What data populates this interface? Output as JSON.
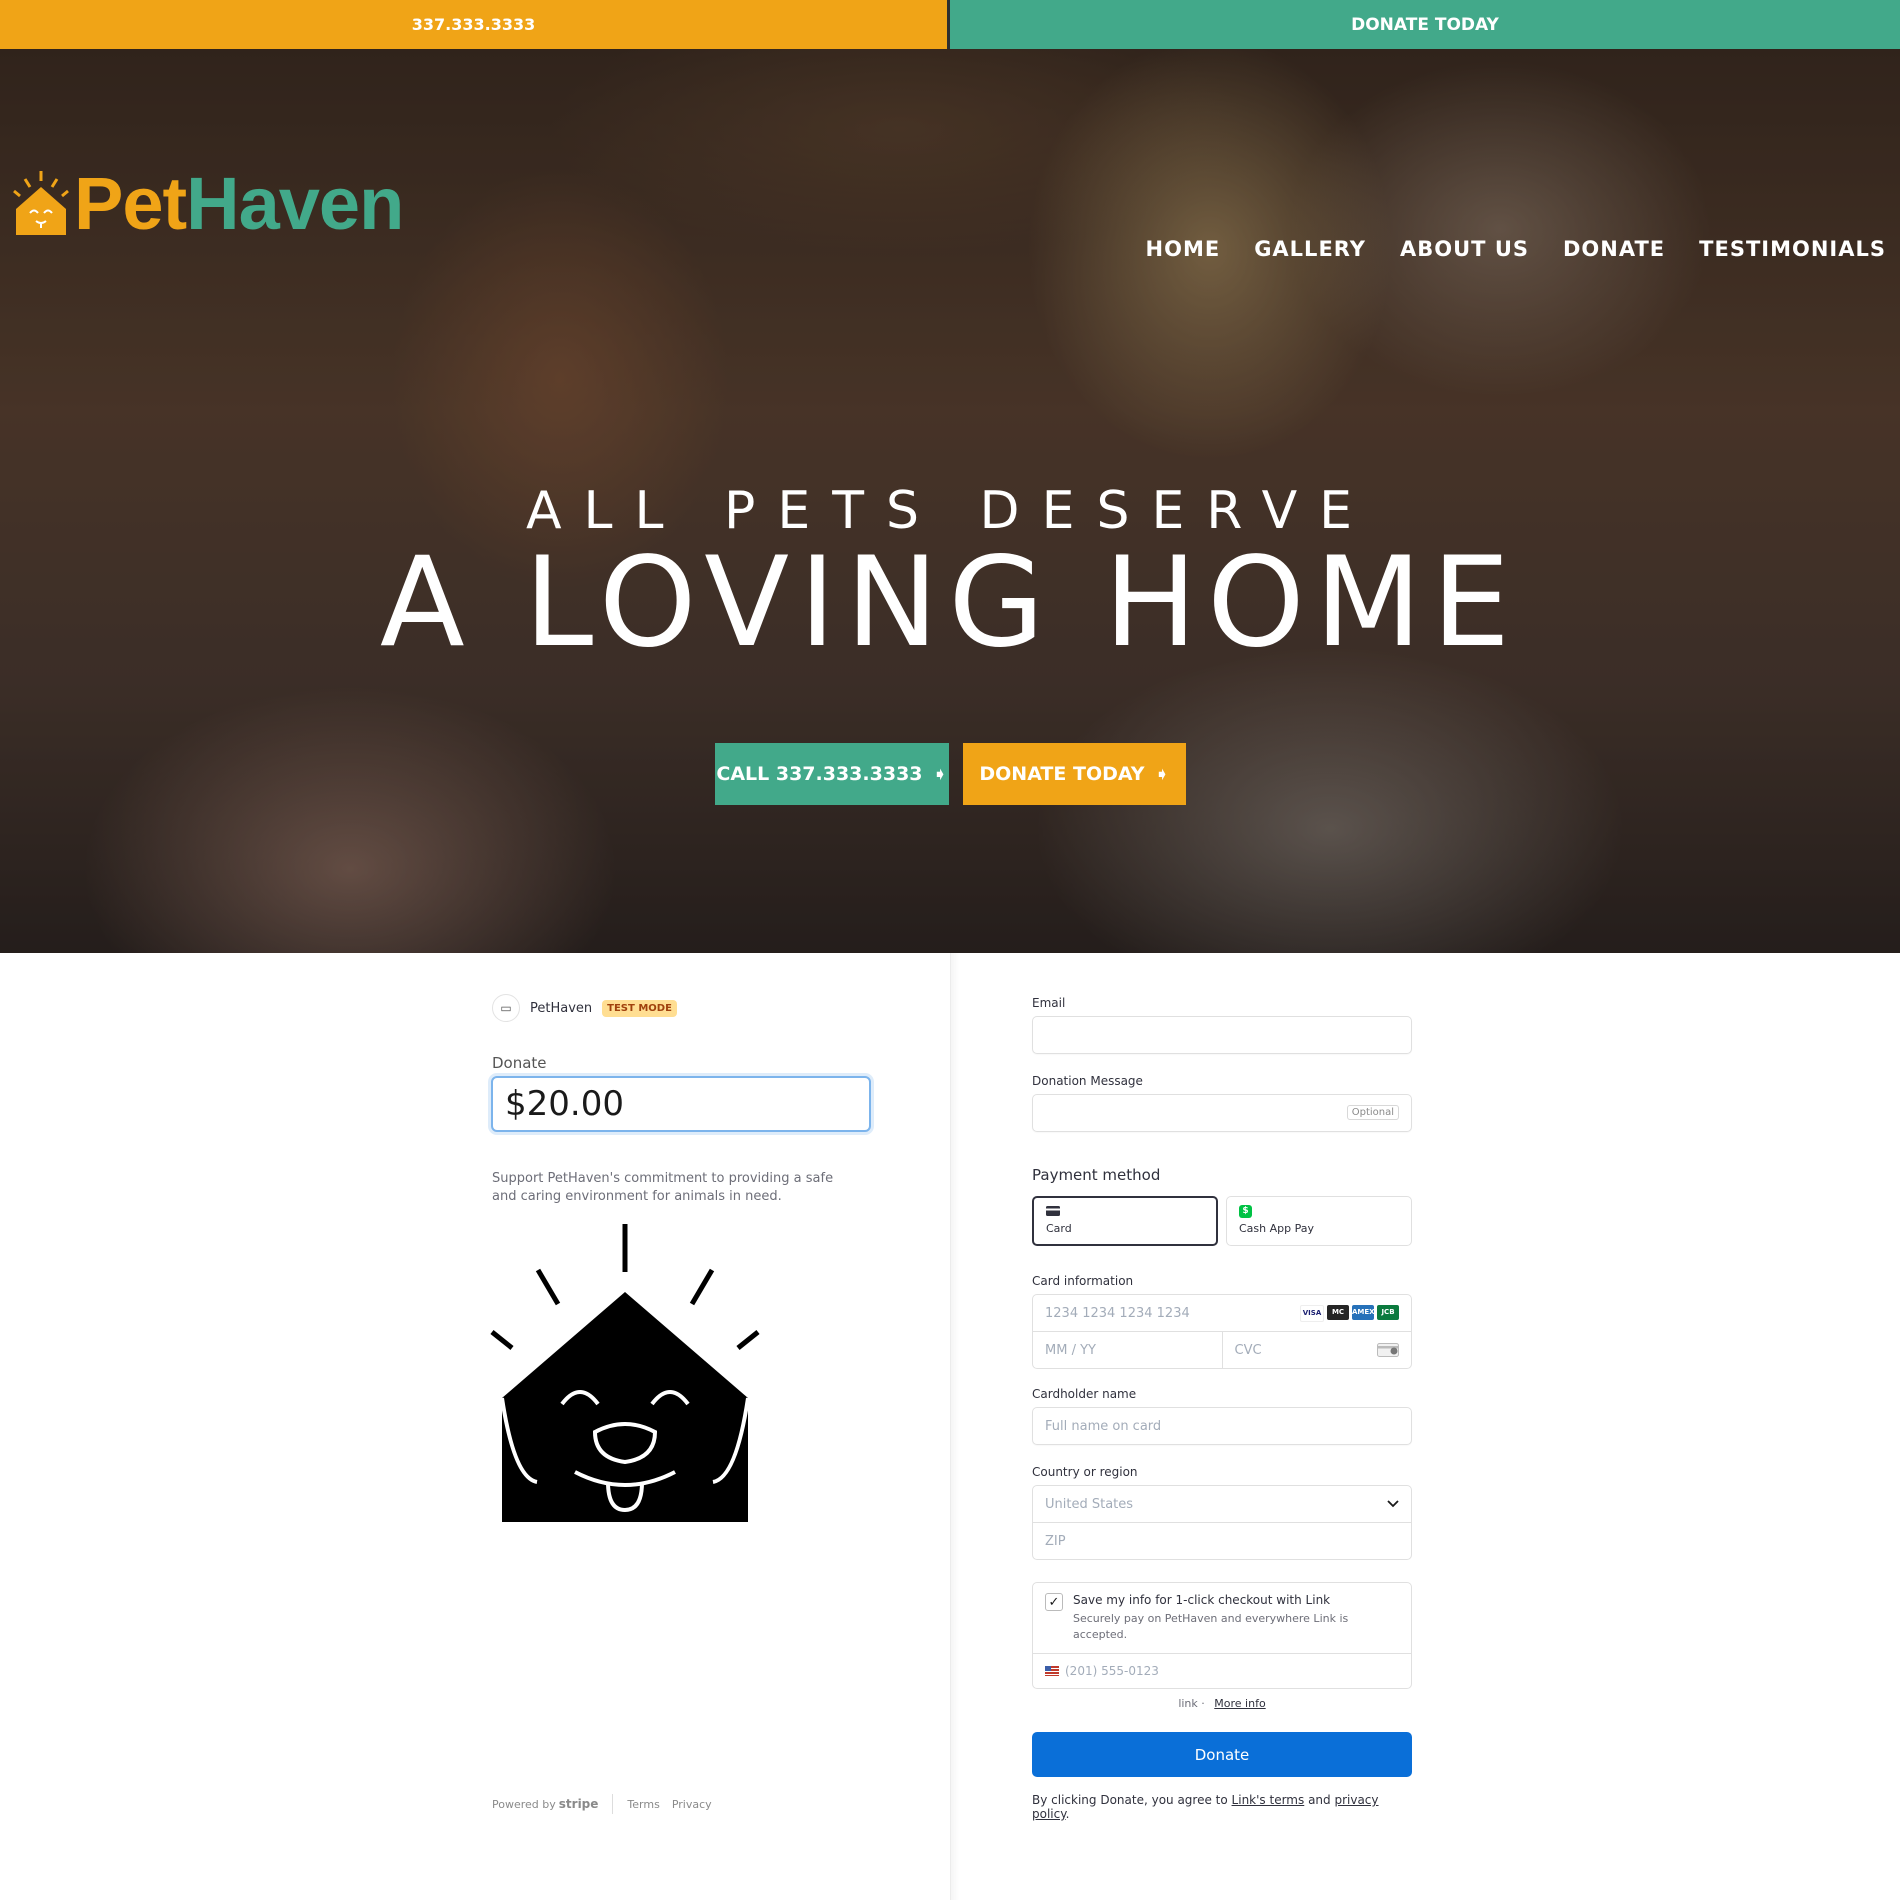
{
  "topbar": {
    "phone": "337.333.3333",
    "donate": "DONATE TODAY"
  },
  "brand": {
    "word_pet": "Pet",
    "word_haven": "Haven"
  },
  "nav": [
    "HOME",
    "GALLERY",
    "ABOUT US",
    "DONATE",
    "TESTIMONIALS"
  ],
  "hero": {
    "subtitle": "ALL PETS DESERVE",
    "title": "A LOVING HOME",
    "call_button": "CALL 337.333.3333",
    "donate_button": "DONATE TODAY"
  },
  "checkout": {
    "merchant": "PetHaven",
    "test_mode": "TEST MODE",
    "donate_label": "Donate",
    "amount": "$20.00",
    "description": "Support PetHaven's commitment to providing a safe and caring environment for animals in need.",
    "powered_by": "Powered by",
    "stripe": "stripe",
    "terms": "Terms",
    "privacy": "Privacy"
  },
  "form": {
    "email_label": "Email",
    "email_value": "",
    "message_label": "Donation Message",
    "message_value": "",
    "optional": "Optional",
    "payment_method_title": "Payment method",
    "methods": [
      {
        "label": "Card",
        "selected": true
      },
      {
        "label": "Cash App Pay",
        "selected": false
      }
    ],
    "card_info_label": "Card information",
    "card_number_placeholder": "1234 1234 1234 1234",
    "expiry_placeholder": "MM / YY",
    "cvc_placeholder": "CVC",
    "card_brands": [
      "VISA",
      "MC",
      "AMEX",
      "JCB"
    ],
    "cardholder_label": "Cardholder name",
    "cardholder_placeholder": "Full name on card",
    "country_label": "Country or region",
    "country_value": "United States",
    "zip_placeholder": "ZIP",
    "link_save_title": "Save my info for 1-click checkout with Link",
    "link_save_sub": "Securely pay on PetHaven and everywhere Link is accepted.",
    "link_save_checked": true,
    "phone_placeholder": "(201) 555-0123",
    "link_logo": "link",
    "more_info": "More info",
    "donate_button": "Donate",
    "terms_prefix": "By clicking Donate, you agree to ",
    "terms_link": "Link's terms",
    "terms_and": " and ",
    "privacy_link": "privacy policy",
    "terms_suffix": "."
  },
  "colors": {
    "orange": "#f0a417",
    "teal": "#42a98a",
    "stripe_blue": "#0a6fd8"
  }
}
